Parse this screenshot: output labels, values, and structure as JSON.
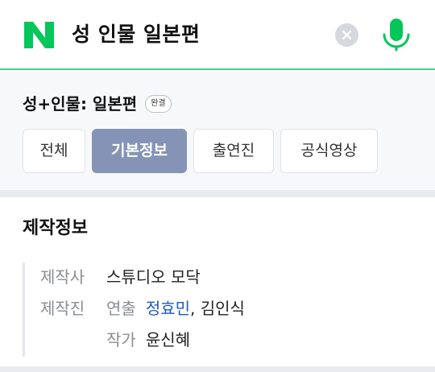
{
  "search": {
    "query": "성 인물 일본편",
    "brand_color": "#03c75a"
  },
  "show": {
    "title": "성+인물: 일본편",
    "badge": "완결"
  },
  "tabs": [
    {
      "label": "전체",
      "active": false
    },
    {
      "label": "기본정보",
      "active": true
    },
    {
      "label": "출연진",
      "active": false
    },
    {
      "label": "공식영상",
      "active": false
    }
  ],
  "production": {
    "section_title": "제작정보",
    "studio_label": "제작사",
    "studio_value": "스튜디오 모닥",
    "staff_label": "제작진",
    "director_label": "연출",
    "director_link": "정효민",
    "director_sep": ",",
    "director_other": " 김인식",
    "writer_label": "작가",
    "writer_value": "윤신혜"
  },
  "icons": {
    "logo": "naver-n-logo",
    "clear": "close-icon",
    "mic": "microphone-icon"
  },
  "colors": {
    "accent_green": "#3fd08a",
    "active_tab": "#8594b6",
    "link_blue": "#1f5ac0"
  }
}
